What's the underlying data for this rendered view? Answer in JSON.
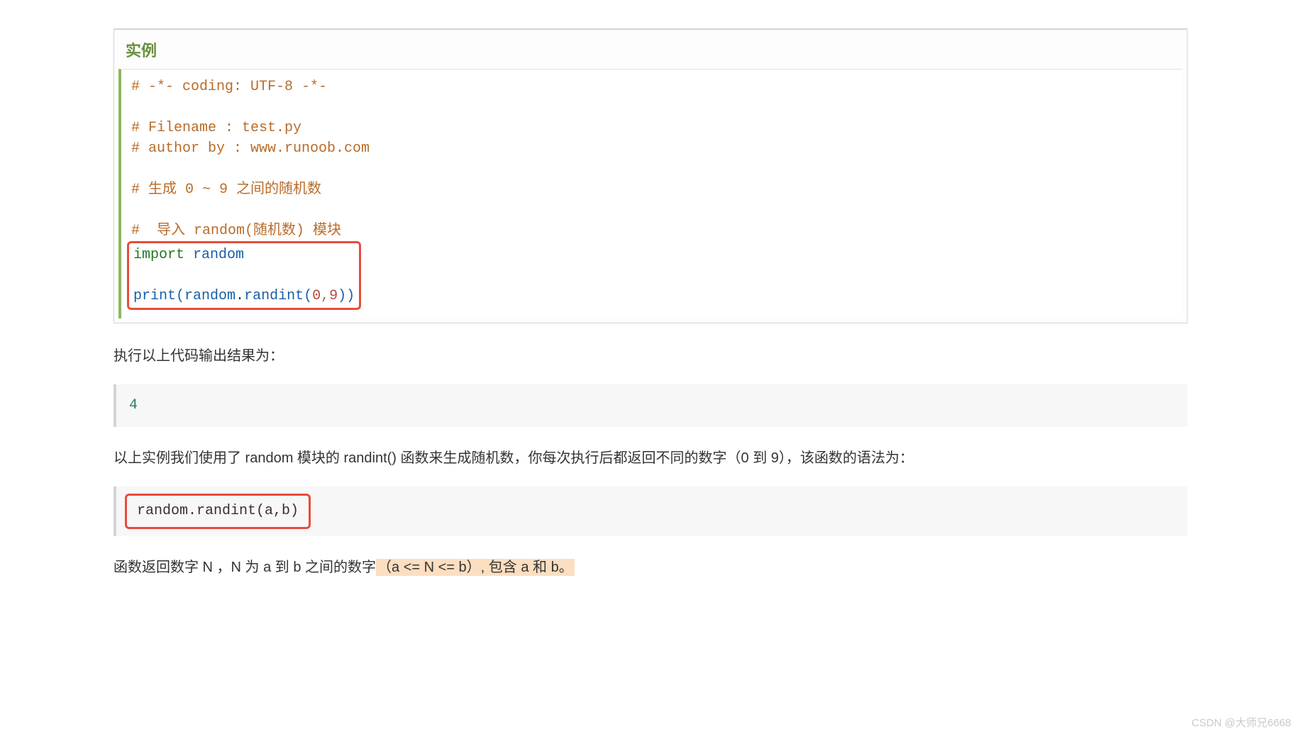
{
  "example": {
    "title": "实例",
    "code": {
      "line1": "# -*- coding: UTF-8 -*-",
      "line2": "# Filename : test.py",
      "line3": "# author by : www.runoob.com",
      "line4": "# 生成 0 ~ 9 之间的随机数",
      "line5": "#  导入 random(随机数) 模块",
      "import_kw": "import",
      "import_mod": "random",
      "print_fn": "print",
      "rand_mod": "random",
      "rand_fn": "randint",
      "arg0": "0",
      "arg1": "9"
    }
  },
  "text1": "执行以上代码输出结果为：",
  "output": "4",
  "text2": "以上实例我们使用了 random 模块的 randint() 函数来生成随机数，你每次执行后都返回不同的数字（0 到 9），该函数的语法为：",
  "syntax": "random.randint(a,b)",
  "text3_pre": "函数返回数字 N ，N 为 a 到 b 之间的数字",
  "text3_hl": "（a <= N <= b）,  包含 a 和 b。",
  "watermark": "CSDN @大师兄6668"
}
